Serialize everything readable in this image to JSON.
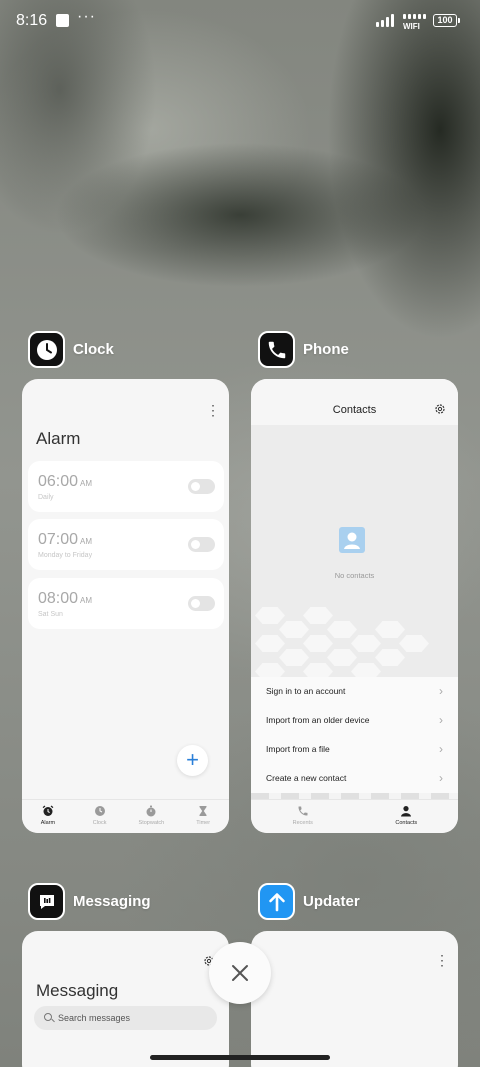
{
  "status_bar": {
    "time": "8:16",
    "dots": "···",
    "wifi_label": "WIFI",
    "battery": "100"
  },
  "recents": {
    "clock": {
      "app_name": "Clock",
      "icon": "clock-icon",
      "screen_title": "Alarm",
      "alarms": [
        {
          "time": "06:00",
          "ampm": "AM",
          "repeat": "Daily",
          "enabled": false
        },
        {
          "time": "07:00",
          "ampm": "AM",
          "repeat": "Monday to Friday",
          "enabled": false
        },
        {
          "time": "08:00",
          "ampm": "AM",
          "repeat": "Sat Sun",
          "enabled": false
        }
      ],
      "tabs": [
        {
          "label": "Alarm",
          "icon": "alarm-icon",
          "active": true
        },
        {
          "label": "Clock",
          "icon": "clock-icon",
          "active": false
        },
        {
          "label": "Stopwatch",
          "icon": "stopwatch-icon",
          "active": false
        },
        {
          "label": "Timer",
          "icon": "hourglass-icon",
          "active": false
        }
      ]
    },
    "phone": {
      "app_name": "Phone",
      "icon": "phone-icon",
      "screen_title": "Contacts",
      "empty_text": "No contacts",
      "menu": [
        "Sign in to an account",
        "Import from an older device",
        "Import from a file",
        "Create a new contact"
      ],
      "tabs": [
        {
          "label": "Recents",
          "icon": "phone-icon",
          "active": false
        },
        {
          "label": "Contacts",
          "icon": "person-icon",
          "active": true
        }
      ]
    },
    "messaging": {
      "app_name": "Messaging",
      "icon": "message-icon",
      "screen_title": "Messaging",
      "search_placeholder": "Search messages"
    },
    "updater": {
      "app_name": "Updater",
      "icon": "arrow-up-icon"
    }
  },
  "colors": {
    "accent_blue": "#2a7fd8",
    "updater_icon": "#2196f3"
  }
}
